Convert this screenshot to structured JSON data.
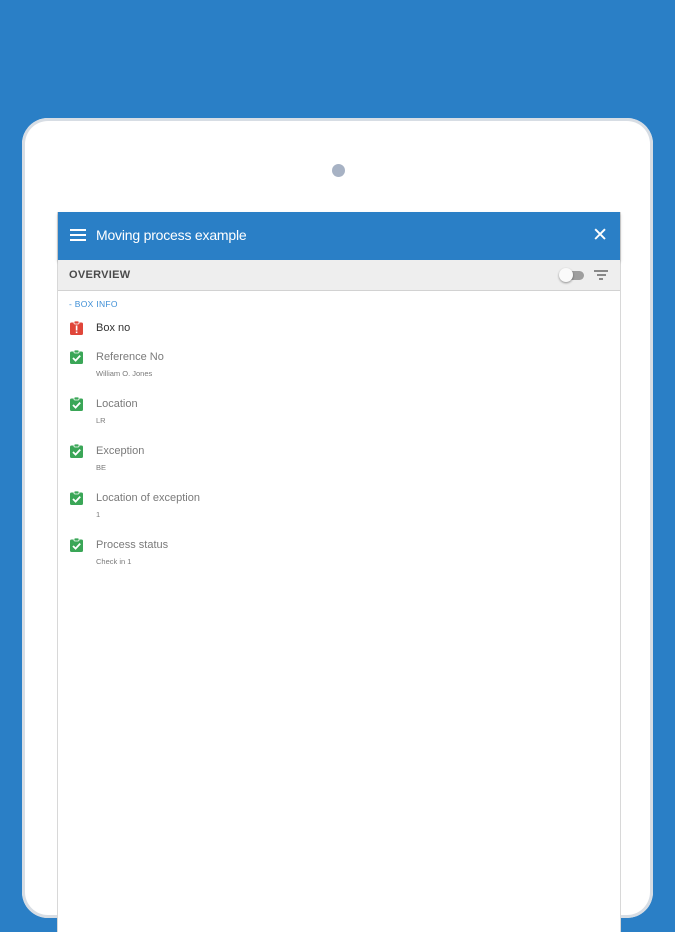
{
  "app": {
    "title": "Moving process example"
  },
  "overview": {
    "title": "OVERVIEW",
    "toggle_on": false
  },
  "section": {
    "header": "- BOX INFO"
  },
  "fields": [
    {
      "label": "Box no",
      "value": "",
      "status": "error"
    },
    {
      "label": "Reference No",
      "value": "William O. Jones",
      "status": "complete"
    },
    {
      "label": "Location",
      "value": "LR",
      "status": "complete"
    },
    {
      "label": "Exception",
      "value": "BE",
      "status": "complete"
    },
    {
      "label": "Location of exception",
      "value": "1",
      "status": "complete"
    },
    {
      "label": "Process status",
      "value": "Check in 1",
      "status": "complete"
    }
  ],
  "colors": {
    "brand": "#2a7fc6",
    "complete": "#3aa657",
    "error": "#e0463a"
  },
  "icons": {
    "menu": "menu-icon",
    "close": "close-icon",
    "filter": "filter-icon",
    "complete": "clipboard-check-icon",
    "error": "clipboard-alert-icon"
  }
}
